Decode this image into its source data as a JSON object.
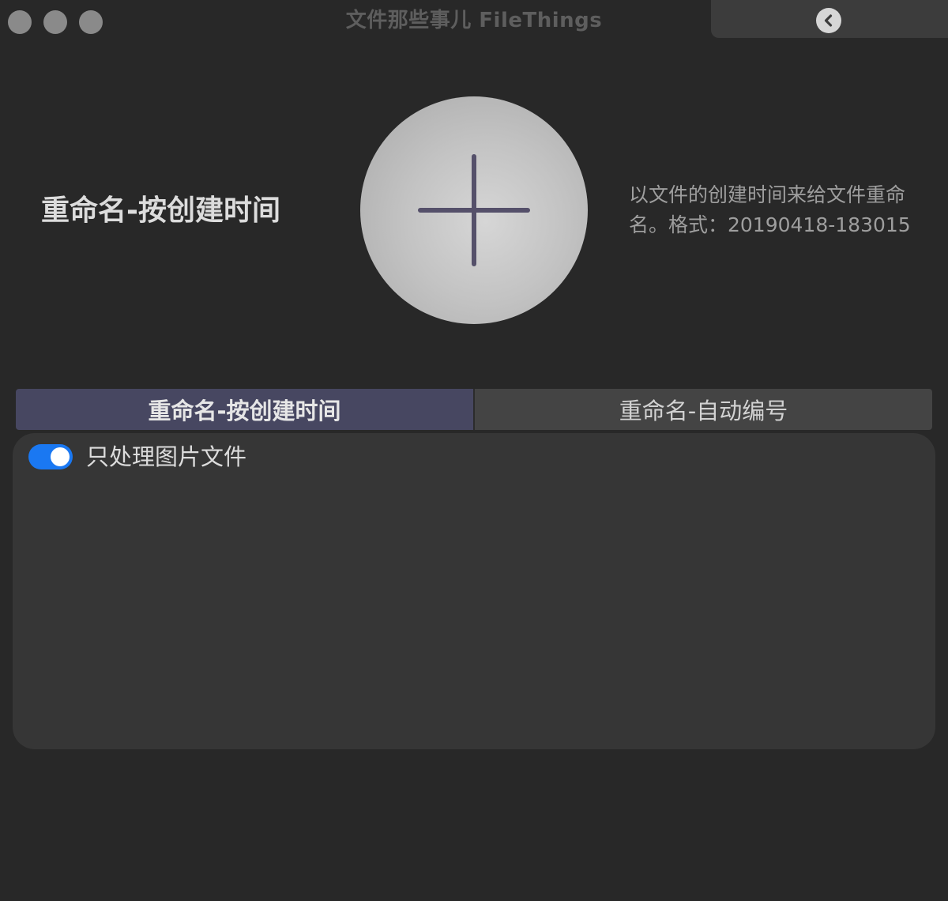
{
  "window": {
    "title": "文件那些事儿 FileThings"
  },
  "hero": {
    "heading": "重命名-按创建时间",
    "description": "以文件的创建时间来给文件重命名。格式：20190418-183015",
    "drop_icon": "plus-icon"
  },
  "tabs": [
    {
      "label": "重命名-按创建时间",
      "active": true
    },
    {
      "label": "重命名-自动编号",
      "active": false
    }
  ],
  "options": {
    "images_only": {
      "label": "只处理图片文件",
      "enabled": true
    }
  },
  "colors": {
    "background": "#282828",
    "active_tab": "#474761",
    "toggle_on": "#1a78f2",
    "plus_icon": "#55506a"
  },
  "icons": {
    "back": "chevron-left-circle-icon"
  }
}
